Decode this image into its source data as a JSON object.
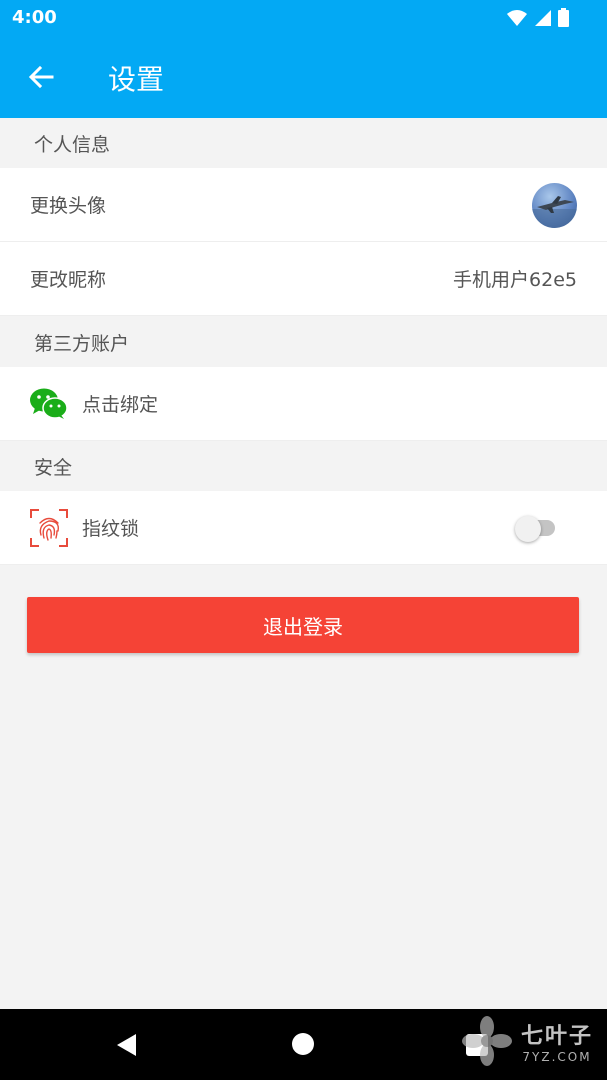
{
  "status_bar": {
    "time": "4:00",
    "icons": [
      "wifi-icon",
      "signal-icon",
      "battery-icon"
    ]
  },
  "app_bar": {
    "title": "设置",
    "back_icon": "arrow-left-icon",
    "background": "#03a9f4"
  },
  "sections": {
    "personal": {
      "header": "个人信息",
      "avatar_label": "更换头像",
      "nickname_label": "更改昵称",
      "nickname_value": "手机用户62e5"
    },
    "third_party": {
      "header": "第三方账户",
      "wechat_label": "点击绑定",
      "wechat_icon": "wechat-icon"
    },
    "security": {
      "header": "安全",
      "fingerprint_label": "指纹锁",
      "fingerprint_icon": "fingerprint-icon",
      "fingerprint_enabled": false
    }
  },
  "logout_button": {
    "label": "退出登录",
    "color": "#f54336"
  },
  "nav_bar": {
    "icons": [
      "back-triangle-icon",
      "home-circle-icon",
      "recents-square-icon"
    ]
  },
  "watermark": {
    "main": "七叶子",
    "sub": "7YZ.COM"
  }
}
